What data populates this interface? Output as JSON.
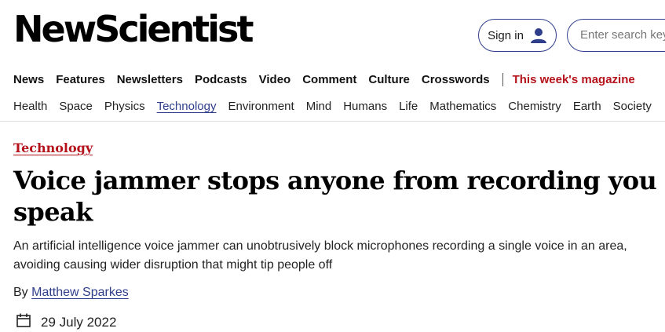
{
  "brand": {
    "logo_text": "NewScientist"
  },
  "header": {
    "sign_in_label": "Sign in",
    "sign_in_icon": "user-icon",
    "search_placeholder": "Enter search keywords"
  },
  "primary_nav": {
    "items": [
      "News",
      "Features",
      "Newsletters",
      "Podcasts",
      "Video",
      "Comment",
      "Culture",
      "Crosswords"
    ],
    "magazine_label": "This week's magazine"
  },
  "topic_nav": {
    "items": [
      "Health",
      "Space",
      "Physics",
      "Technology",
      "Environment",
      "Mind",
      "Humans",
      "Life",
      "Mathematics",
      "Chemistry",
      "Earth",
      "Society"
    ],
    "active": "Technology"
  },
  "article": {
    "section": "Technology",
    "headline": "Voice jammer stops anyone from recording you speak",
    "standfirst": "An artificial intelligence voice jammer can unobtrusively block microphones recording a single voice in an area, avoiding causing wider disruption that might tip people off",
    "byline_prefix": "By",
    "author": "Matthew Sparkes",
    "date": "29 July 2022",
    "date_icon": "calendar-icon"
  },
  "colors": {
    "accent_red": "#b5121b",
    "link_blue": "#2f3e8a"
  }
}
